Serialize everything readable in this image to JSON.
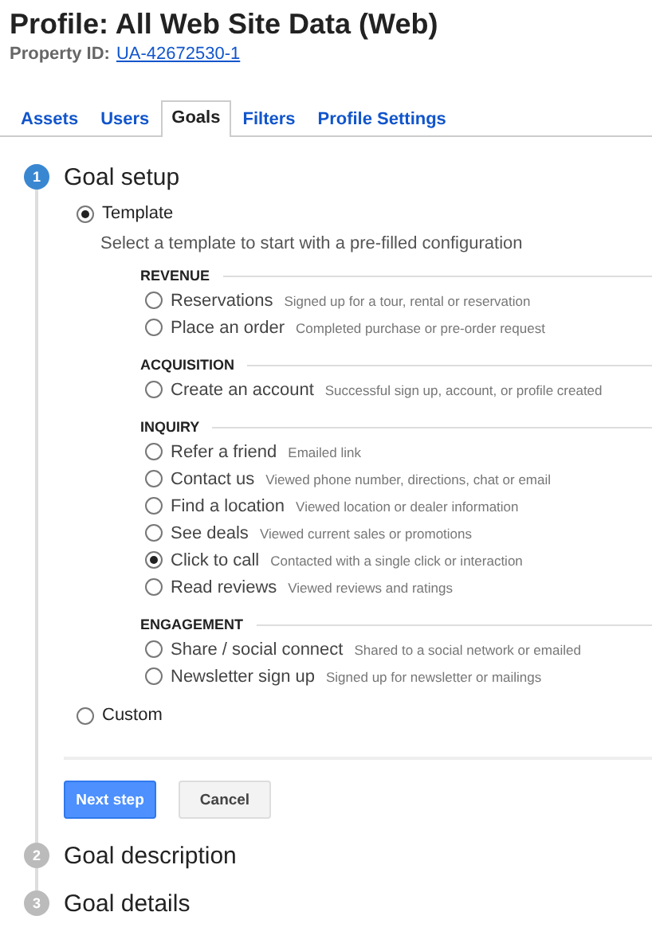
{
  "header": {
    "title": "Profile: All Web Site Data (Web)",
    "property_label": "Property ID:",
    "property_id": "UA-42672530-1"
  },
  "tabs": [
    {
      "label": "Assets",
      "selected": false
    },
    {
      "label": "Users",
      "selected": false
    },
    {
      "label": "Goals",
      "selected": true
    },
    {
      "label": "Filters",
      "selected": false
    },
    {
      "label": "Profile Settings",
      "selected": false
    }
  ],
  "steps": [
    {
      "number": "1",
      "title": "Goal setup",
      "selected": true
    },
    {
      "number": "2",
      "title": "Goal description",
      "selected": false
    },
    {
      "number": "3",
      "title": "Goal details",
      "selected": false
    }
  ],
  "goal_setup": {
    "template": {
      "label": "Template",
      "checked": true,
      "hint": "Select a template to start with a pre-filled configuration"
    },
    "categories": [
      {
        "title": "REVENUE",
        "goals": [
          {
            "name": "Reservations",
            "description": "Signed up for a tour, rental or reservation",
            "checked": false
          },
          {
            "name": "Place an order",
            "description": "Completed purchase or pre-order request",
            "checked": false
          }
        ]
      },
      {
        "title": "ACQUISITION",
        "goals": [
          {
            "name": "Create an account",
            "description": "Successful sign up, account, or profile created",
            "checked": false
          }
        ]
      },
      {
        "title": "INQUIRY",
        "goals": [
          {
            "name": "Refer a friend",
            "description": "Emailed link",
            "checked": false
          },
          {
            "name": "Contact us",
            "description": "Viewed phone number, directions, chat or email",
            "checked": false
          },
          {
            "name": "Find a location",
            "description": "Viewed location or dealer information",
            "checked": false
          },
          {
            "name": "See deals",
            "description": "Viewed current sales or promotions",
            "checked": false
          },
          {
            "name": "Click to call",
            "description": "Contacted with a single click or interaction",
            "checked": true
          },
          {
            "name": "Read reviews",
            "description": "Viewed reviews and ratings",
            "checked": false
          }
        ]
      },
      {
        "title": "ENGAGEMENT",
        "goals": [
          {
            "name": "Share / social connect",
            "description": "Shared to a social network or emailed",
            "checked": false
          },
          {
            "name": "Newsletter sign up",
            "description": "Signed up for newsletter or mailings",
            "checked": false
          }
        ]
      }
    ],
    "custom": {
      "label": "Custom",
      "checked": false
    },
    "buttons": [
      {
        "label": "Next step",
        "kind": "primary"
      },
      {
        "label": "Cancel",
        "kind": "secondary"
      }
    ]
  }
}
